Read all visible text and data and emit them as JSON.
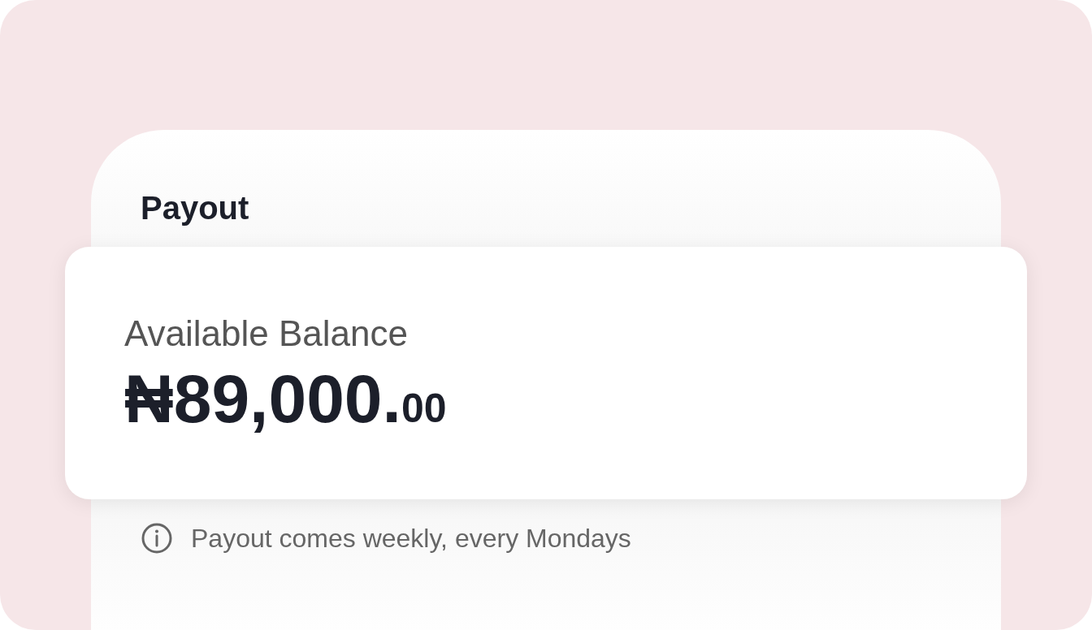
{
  "header": {
    "title": "Payout"
  },
  "balance_card": {
    "label": "Available Balance",
    "amount_main": "₦89,000.",
    "amount_fraction": "00"
  },
  "note": {
    "text": "Payout comes weekly, every Mondays"
  }
}
